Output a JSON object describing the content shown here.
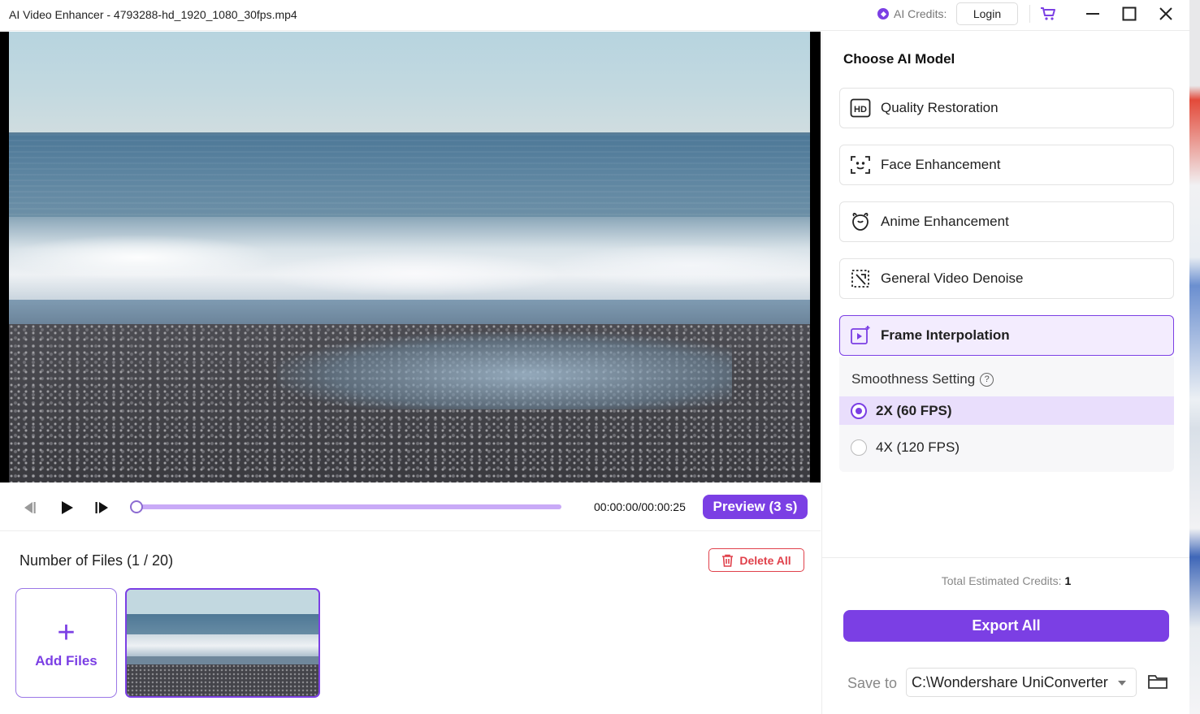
{
  "window": {
    "title": "AI Video Enhancer - 4793288-hd_1920_1080_30fps.mp4",
    "credits_label": "AI Credits:",
    "login_label": "Login"
  },
  "player": {
    "timecode": "00:00:00/00:00:25",
    "preview_label": "Preview (3 s)",
    "progress": 0
  },
  "files": {
    "count_label": "Number of Files (1 / 20)",
    "delete_all_label": "Delete All",
    "add_files_label": "Add Files",
    "add_files_plus": "+"
  },
  "panel": {
    "title": "Choose AI Model",
    "models": [
      {
        "label": "Quality Restoration",
        "icon": "hd-icon",
        "selected": false
      },
      {
        "label": "Face Enhancement",
        "icon": "face-scan-icon",
        "selected": false
      },
      {
        "label": "Anime Enhancement",
        "icon": "anime-character-icon",
        "selected": false
      },
      {
        "label": "General Video Denoise",
        "icon": "denoise-icon",
        "selected": false
      },
      {
        "label": "Frame Interpolation",
        "icon": "frame-interpolation-icon",
        "selected": true
      }
    ],
    "smoothness_label": "Smoothness Setting",
    "help_glyph": "?",
    "options": [
      {
        "label": "2X (60 FPS)",
        "selected": true
      },
      {
        "label": "4X (120 FPS)",
        "selected": false
      }
    ],
    "estimated_label": "Total Estimated Credits:",
    "estimated_value": "1",
    "export_label": "Export All",
    "save_to_label": "Save to",
    "save_path": "C:\\Wondershare UniConverter"
  },
  "colors": {
    "accent": "#7b3fe4",
    "accent_light": "#f3ecfe",
    "danger": "#e0414b"
  }
}
